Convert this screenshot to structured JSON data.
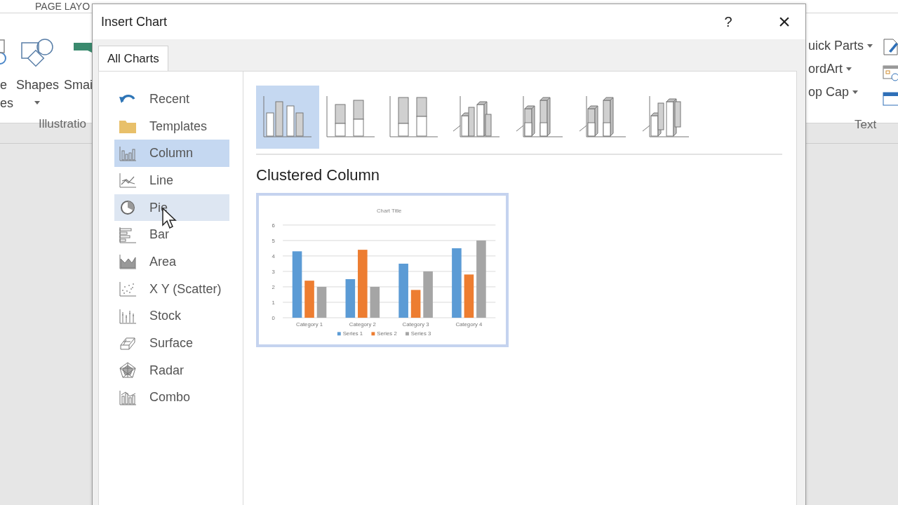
{
  "ribbon": {
    "tab": "PAGE LAYO",
    "left": {
      "cut_labels": [
        "e",
        "es"
      ],
      "shapes": "Shapes",
      "smartart": "Smai",
      "group": "Illustratio"
    },
    "right": {
      "items": [
        "uick Parts",
        "ordArt",
        "op Cap"
      ],
      "group": "Text"
    }
  },
  "dialog": {
    "title": "Insert Chart",
    "help": "?",
    "close": "×",
    "tabs": [
      {
        "label": "All Charts",
        "selected": true
      }
    ],
    "types": [
      {
        "label": "Recent",
        "selected": false,
        "hovered": false
      },
      {
        "label": "Templates",
        "selected": false,
        "hovered": false
      },
      {
        "label": "Column",
        "selected": true,
        "hovered": false
      },
      {
        "label": "Line",
        "selected": false,
        "hovered": false
      },
      {
        "label": "Pie",
        "selected": false,
        "hovered": true
      },
      {
        "label": "Bar",
        "selected": false,
        "hovered": false
      },
      {
        "label": "Area",
        "selected": false,
        "hovered": false
      },
      {
        "label": "X Y (Scatter)",
        "selected": false,
        "hovered": false
      },
      {
        "label": "Stock",
        "selected": false,
        "hovered": false
      },
      {
        "label": "Surface",
        "selected": false,
        "hovered": false
      },
      {
        "label": "Radar",
        "selected": false,
        "hovered": false
      },
      {
        "label": "Combo",
        "selected": false,
        "hovered": false
      }
    ],
    "subtypes": [
      {
        "selected": true
      },
      {
        "selected": false
      },
      {
        "selected": false
      },
      {
        "selected": false
      },
      {
        "selected": false
      },
      {
        "selected": false
      },
      {
        "selected": false
      }
    ],
    "subtype_title": "Clustered Column",
    "preview": {
      "chart_data": {
        "type": "bar",
        "title": "Chart Title",
        "categories": [
          "Category 1",
          "Category 2",
          "Category 3",
          "Category 4"
        ],
        "series": [
          {
            "name": "Series 1",
            "color": "#5b9bd5",
            "values": [
              4.3,
              2.5,
              3.5,
              4.5
            ]
          },
          {
            "name": "Series 2",
            "color": "#ed7d31",
            "values": [
              2.4,
              4.4,
              1.8,
              2.8
            ]
          },
          {
            "name": "Series 3",
            "color": "#a5a5a5",
            "values": [
              2,
              2,
              3,
              5
            ]
          }
        ],
        "ylim": [
          0,
          6
        ],
        "yticks": [
          0,
          1,
          2,
          3,
          4,
          5,
          6
        ],
        "grid": true,
        "legend": true
      }
    }
  }
}
